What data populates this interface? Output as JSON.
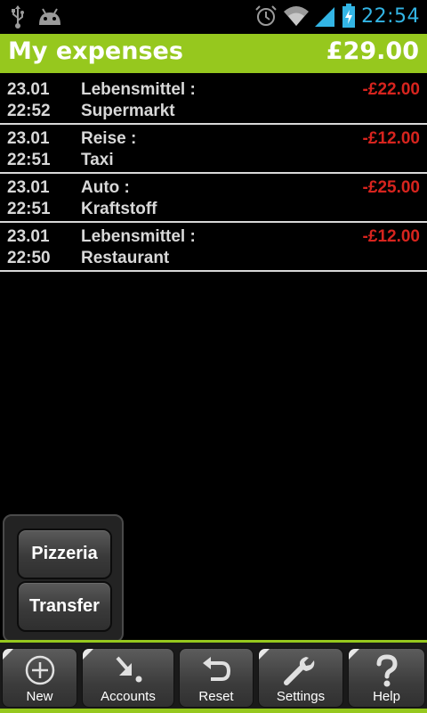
{
  "status_bar": {
    "time": "22:54",
    "icons": [
      "usb-icon",
      "android-icon",
      "alarm-icon",
      "wifi-icon",
      "signal-icon",
      "battery-charging-icon"
    ],
    "time_color": "#33b5e5"
  },
  "header": {
    "title": "My expenses",
    "total": "£29.00",
    "color": "#96c81e"
  },
  "expenses": [
    {
      "date": "23.01",
      "time": "22:52",
      "category": "Lebensmittel :",
      "subcategory": "Supermarkt",
      "amount": "-£22.00"
    },
    {
      "date": "23.01",
      "time": "22:51",
      "category": "Reise :",
      "subcategory": "Taxi",
      "amount": "-£12.00"
    },
    {
      "date": "23.01",
      "time": "22:51",
      "category": "Auto :",
      "subcategory": "Kraftstoff",
      "amount": "-£25.00"
    },
    {
      "date": "23.01",
      "time": "22:50",
      "category": "Lebensmittel :",
      "subcategory": "Restaurant",
      "amount": "-£12.00"
    }
  ],
  "amount_color": "#d7241e",
  "popup": {
    "items": [
      "Pizzeria",
      "Transfer"
    ]
  },
  "toolbar": {
    "new_label": "New",
    "accounts_label": "Accounts",
    "reset_label": "Reset",
    "settings_label": "Settings",
    "help_label": "Help"
  }
}
